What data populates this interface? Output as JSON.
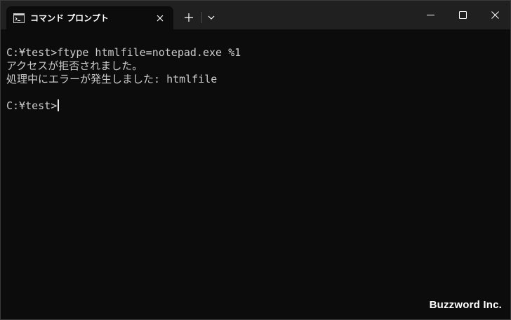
{
  "tab": {
    "title": "コマンド プロンプト",
    "icon": "cmd-icon"
  },
  "terminal": {
    "lines": [
      "C:¥test>ftype htmlfile=notepad.exe %1",
      "アクセスが拒否されました。",
      "処理中にエラーが発生しました: htmlfile",
      "",
      "C:¥test>"
    ]
  },
  "watermark": "Buzzword Inc.",
  "colors": {
    "background": "#0c0c0c",
    "titlebar": "#202020",
    "text": "#cccccc"
  }
}
